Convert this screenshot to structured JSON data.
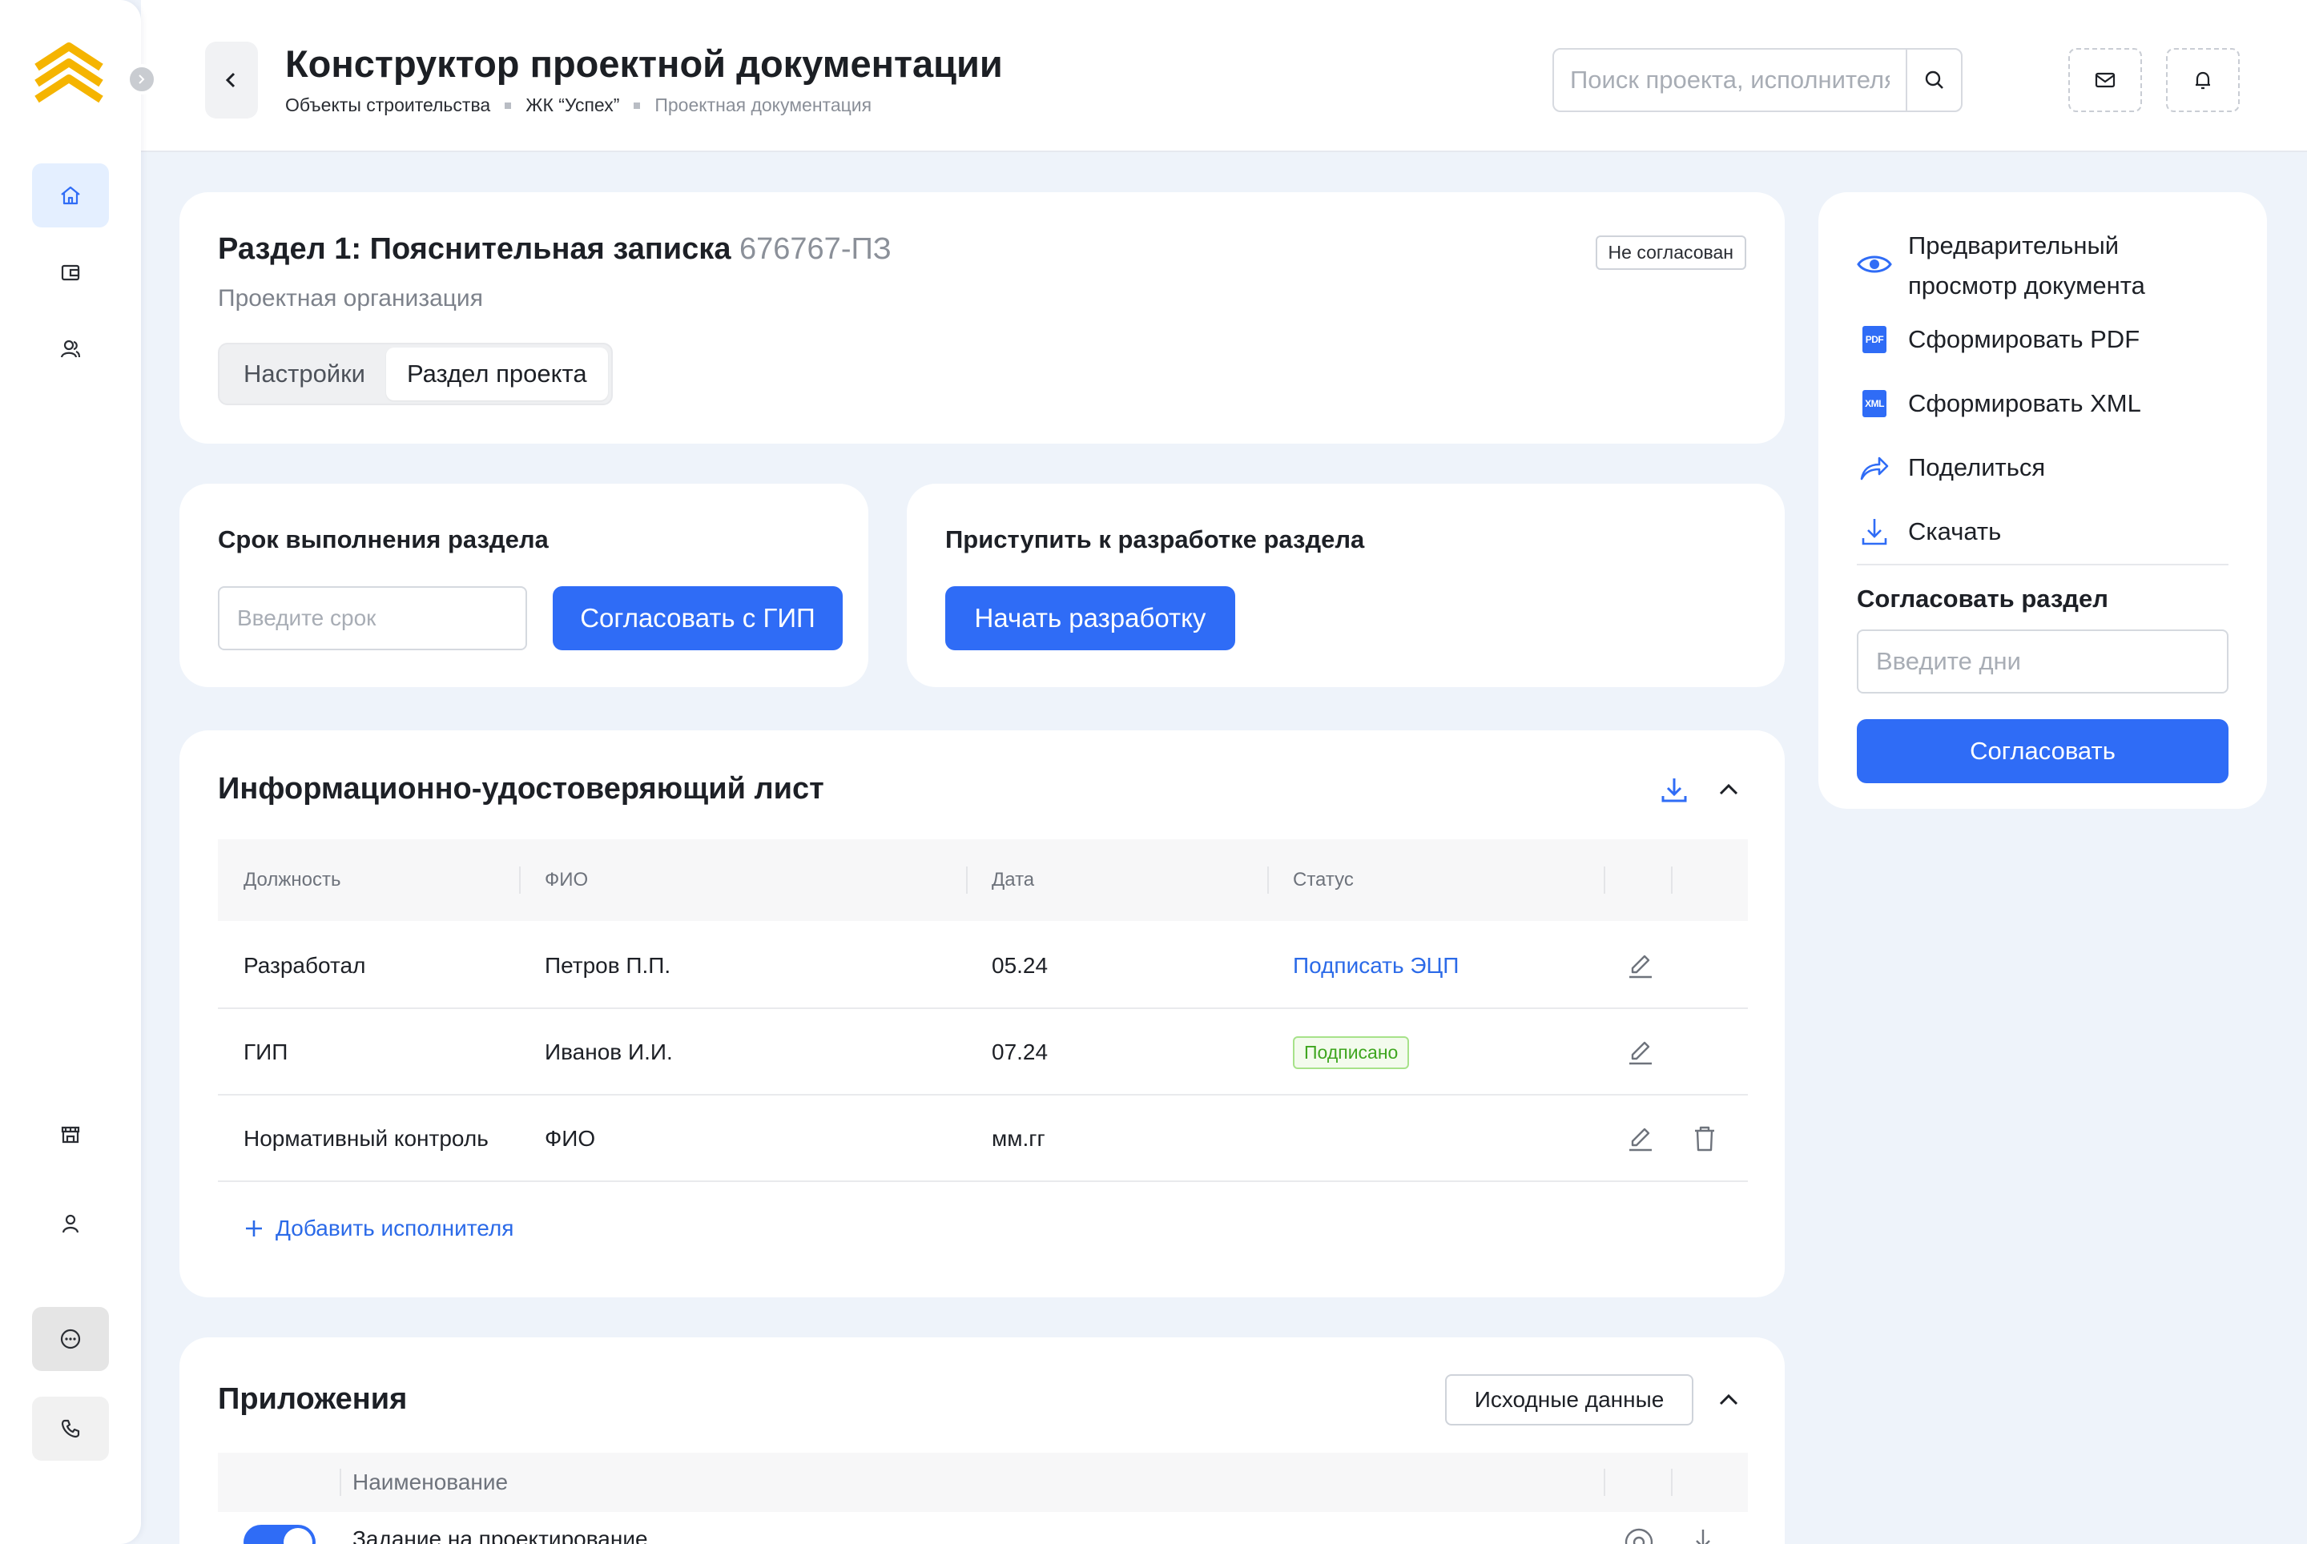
{
  "header": {
    "title": "Конструктор проектной документации",
    "breadcrumb": [
      "Объекты строительства",
      "ЖК “Успех”",
      "Проектная документация"
    ],
    "search_placeholder": "Поиск проекта, исполнителя"
  },
  "section": {
    "title": "Раздел 1: Пояснительная записка",
    "code": "676767-ПЗ",
    "org": "Проектная организация",
    "status": "Не согласован",
    "tabs": [
      "Настройки",
      "Раздел проекта"
    ],
    "active_tab": "Раздел проекта"
  },
  "deadline": {
    "title": "Срок выполнения раздела",
    "input_placeholder": "Введите срок",
    "button": "Согласовать с ГИП"
  },
  "start_dev": {
    "title": "Приступить к разработке раздела",
    "button": "Начать разработку"
  },
  "info_sheet": {
    "title": "Информационно-удостоверяющий лист",
    "columns": [
      "Должность",
      "ФИО",
      "Дата",
      "Статус"
    ],
    "rows": [
      {
        "role": "Разработал",
        "name": "Петров П.П.",
        "date": "05.24",
        "status": "Подписать ЭЦП"
      },
      {
        "role": "ГИП",
        "name": "Иванов И.И.",
        "date": "07.24",
        "status": "Подписано"
      },
      {
        "role": "Нормативный контроль",
        "name": "ФИО",
        "date": "мм.гг",
        "status": ""
      }
    ],
    "add_label": "Добавить исполнителя"
  },
  "attachments": {
    "title": "Приложения",
    "source_button": "Исходные данные",
    "column": "Наименование",
    "first_row": "Задание на проектирование"
  },
  "right_panel": {
    "actions": [
      {
        "label": "Предварительный просмотр документа",
        "icon": "eye-icon"
      },
      {
        "label": "Сформировать PDF",
        "icon": "pdf-file-icon",
        "badge": "PDF"
      },
      {
        "label": "Сформировать XML",
        "icon": "xml-file-icon",
        "badge": "XML"
      },
      {
        "label": "Поделиться",
        "icon": "share-icon"
      },
      {
        "label": "Скачать",
        "icon": "download-icon"
      }
    ],
    "approve_title": "Согласовать раздел",
    "days_placeholder": "Введите дни",
    "approve_button": "Согласовать"
  },
  "colors": {
    "accent": "#2f6cf6",
    "logo": "#f5b400",
    "success": "#3fa620",
    "background": "#eef3fa"
  }
}
